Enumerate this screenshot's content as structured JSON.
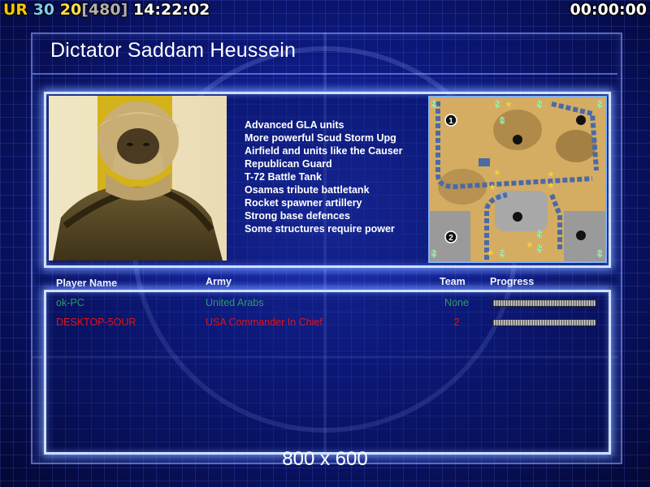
{
  "hud": {
    "ur": "UR",
    "v30": "30",
    "v20": "20",
    "v480": "[480]",
    "clock": "14:22:02",
    "timer": "00:00:00"
  },
  "general": {
    "title": "Dictator Saddam Heussein",
    "features": [
      "Advanced GLA units",
      "More powerful Scud Storm Upg",
      "Airfield and units like the Causer",
      "Republican Guard",
      "T-72 Battle Tank",
      "Osamas tribute battletank",
      "Rocket spawner artillery",
      "Strong base defences",
      "Some structures require power"
    ]
  },
  "minimap": {
    "start_labels": [
      "1",
      "2"
    ]
  },
  "players": {
    "headers": {
      "name": "Player Name",
      "army": "Army",
      "team": "Team",
      "progress": "Progress"
    },
    "rows": [
      {
        "name": "ok-PC",
        "army": "United Arabs",
        "team": "None",
        "color": "#2f9a6a",
        "progress": 1.0
      },
      {
        "name": "DESKTOP-5OUR",
        "army": "USA Commander In Chief",
        "team": "2",
        "color": "#e0141a",
        "progress": 1.0
      }
    ]
  },
  "resolution": "800 x 600",
  "colors": {
    "background": "#0f1c8a",
    "panel_border": "#cfe0ff",
    "hud_ur": "#f5c800",
    "hud_30": "#7fc8ff",
    "hud_20": "#ffe14a",
    "hud_480": "#b0b0b0"
  }
}
